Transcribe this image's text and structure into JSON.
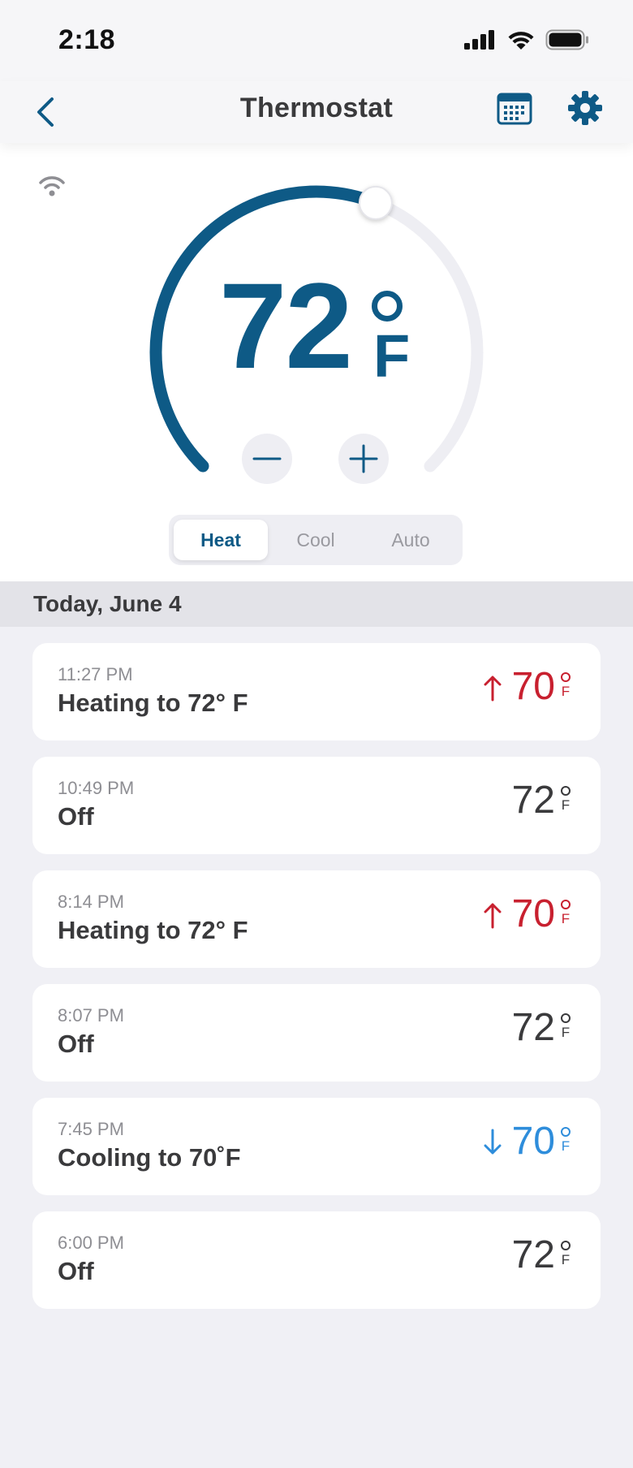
{
  "status_bar": {
    "time": "2:18"
  },
  "nav": {
    "title": "Thermostat"
  },
  "thermostat": {
    "setpoint": "72",
    "unit": "F",
    "dial_fill_fraction": 0.58
  },
  "modes": {
    "options": [
      "Heat",
      "Cool",
      "Auto"
    ],
    "selected": "Heat"
  },
  "day_header": "Today, June 4",
  "events": [
    {
      "time": "11:27 PM",
      "status": "Heating to 72° F",
      "temp": "70",
      "unit": "F",
      "trend": "heating"
    },
    {
      "time": "10:49 PM",
      "status": "Off",
      "temp": "72",
      "unit": "F",
      "trend": "none"
    },
    {
      "time": "8:14 PM",
      "status": "Heating to 72° F",
      "temp": "70",
      "unit": "F",
      "trend": "heating"
    },
    {
      "time": "8:07 PM",
      "status": "Off",
      "temp": "72",
      "unit": "F",
      "trend": "none"
    },
    {
      "time": "7:45 PM",
      "status": "Cooling to 70˚F",
      "temp": "70",
      "unit": "F",
      "trend": "cooling"
    },
    {
      "time": "6:00 PM",
      "status": "Off",
      "temp": "72",
      "unit": "F",
      "trend": "none"
    }
  ],
  "colors": {
    "accent": "#0e5a86",
    "heating": "#c8202f",
    "cooling": "#2e8ddb",
    "track": "#eeeef3"
  }
}
